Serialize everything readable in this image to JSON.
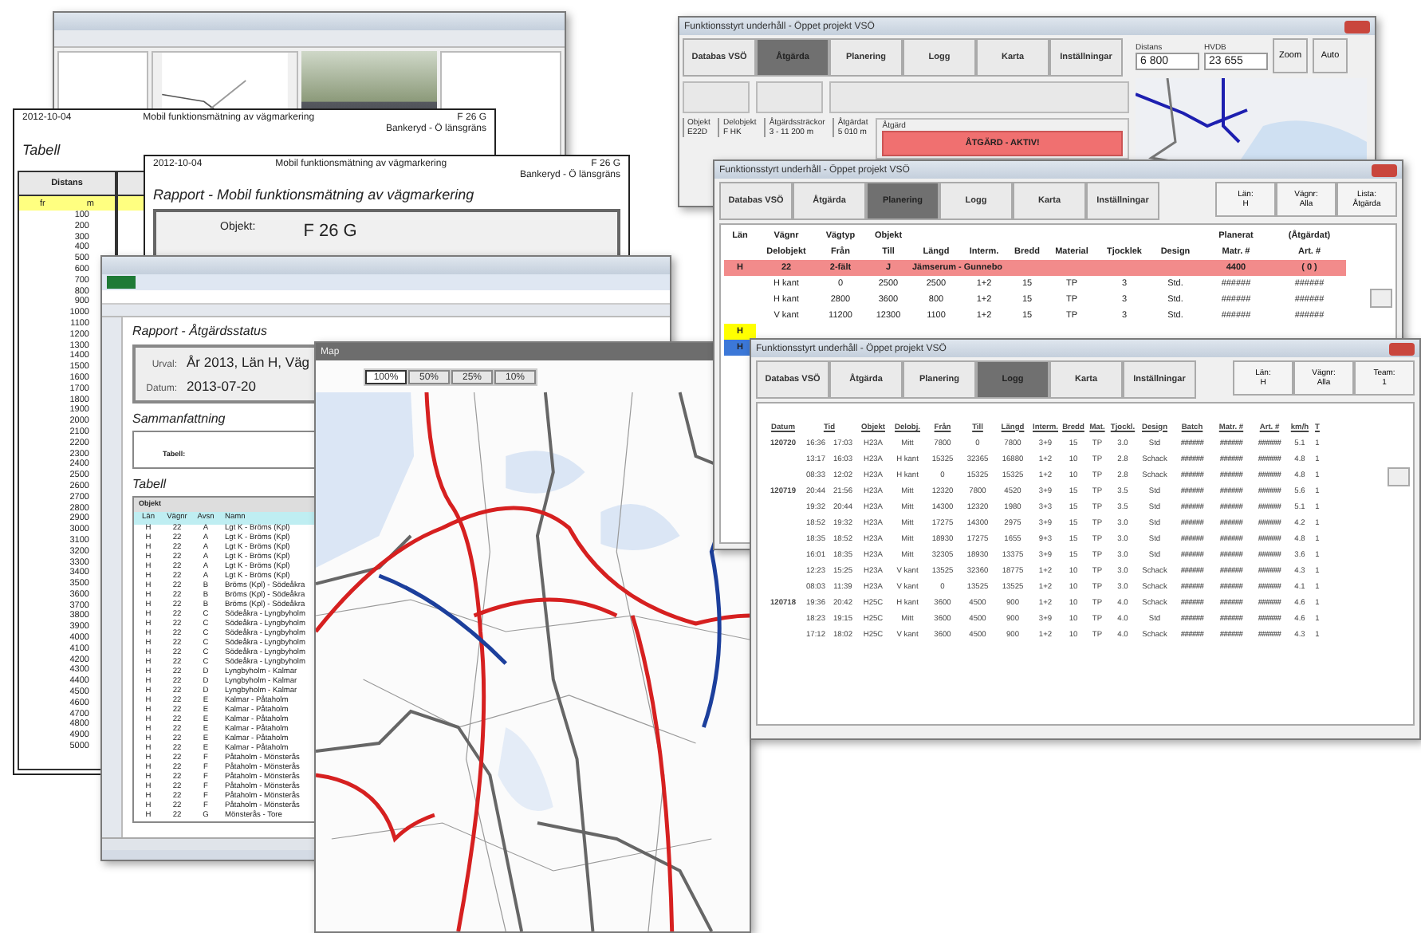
{
  "tabell_report": {
    "date": "2012-10-04",
    "title": "Mobil funktionsmätning av vägmarkering",
    "object": "F 26 G",
    "section": "Bankeryd - Ö länsgräns",
    "heading": "Tabell",
    "column": "Distans",
    "units": [
      "fr",
      "m"
    ],
    "distances": [
      "100",
      "200",
      "300",
      "400",
      "500",
      "600",
      "700",
      "800",
      "900",
      "1000",
      "1100",
      "1200",
      "1300",
      "1400",
      "1500",
      "1600",
      "1700",
      "1800",
      "1900",
      "2000",
      "2100",
      "2200",
      "2300",
      "2400",
      "2500",
      "2600",
      "2700",
      "2800",
      "2900",
      "3000",
      "3100",
      "3200",
      "3300",
      "3400",
      "3500",
      "3600",
      "3700",
      "3800",
      "3900",
      "4000",
      "4100",
      "4200",
      "4300",
      "4400",
      "4500",
      "4600",
      "4700",
      "4800",
      "4900",
      "5000"
    ]
  },
  "rapport_report": {
    "date": "2012-10-04",
    "title": "Mobil funktionsmätning av vägmarkering",
    "object": "F 26 G",
    "section": "Bankeryd - Ö länsgräns",
    "heading": "Rapport - Mobil funktionsmätning av vägmarkering",
    "object_label": "Objekt:",
    "object_value": "F 26 G"
  },
  "excel": {
    "heading": "Rapport - Åtgärdsstatus",
    "filter_label": "Urval:",
    "filter_value": "År 2013, Län H, Väg",
    "date_label": "Datum:",
    "date_value": "2013-07-20",
    "summary_heading": "Sammanfattning",
    "summary_label": "Tabell:",
    "table_heading": "Tabell",
    "group_header": "Objekt",
    "columns": [
      "Län",
      "Vägnr",
      "Avsn",
      "Namn"
    ],
    "rows": [
      [
        "H",
        "22",
        "A",
        "Lgt K - Bröms (Kpl)"
      ],
      [
        "H",
        "22",
        "A",
        "Lgt K - Bröms (Kpl)"
      ],
      [
        "H",
        "22",
        "A",
        "Lgt K - Bröms (Kpl)"
      ],
      [
        "H",
        "22",
        "A",
        "Lgt K - Bröms (Kpl)"
      ],
      [
        "H",
        "22",
        "A",
        "Lgt K - Bröms (Kpl)"
      ],
      [
        "H",
        "22",
        "A",
        "Lgt K - Bröms (Kpl)"
      ],
      [
        "H",
        "22",
        "B",
        "Bröms (Kpl) - Södeåkra"
      ],
      [
        "H",
        "22",
        "B",
        "Bröms (Kpl) - Södeåkra"
      ],
      [
        "H",
        "22",
        "B",
        "Bröms (Kpl) - Södeåkra"
      ],
      [
        "H",
        "22",
        "C",
        "Södeåkra - Lyngbyholm"
      ],
      [
        "H",
        "22",
        "C",
        "Södeåkra - Lyngbyholm"
      ],
      [
        "H",
        "22",
        "C",
        "Södeåkra - Lyngbyholm"
      ],
      [
        "H",
        "22",
        "C",
        "Södeåkra - Lyngbyholm"
      ],
      [
        "H",
        "22",
        "C",
        "Södeåkra - Lyngbyholm"
      ],
      [
        "H",
        "22",
        "C",
        "Södeåkra - Lyngbyholm"
      ],
      [
        "H",
        "22",
        "D",
        "Lyngbyholm - Kalmar"
      ],
      [
        "H",
        "22",
        "D",
        "Lyngbyholm - Kalmar"
      ],
      [
        "H",
        "22",
        "D",
        "Lyngbyholm - Kalmar"
      ],
      [
        "H",
        "22",
        "E",
        "Kalmar - Påtaholm"
      ],
      [
        "H",
        "22",
        "E",
        "Kalmar - Påtaholm"
      ],
      [
        "H",
        "22",
        "E",
        "Kalmar - Påtaholm"
      ],
      [
        "H",
        "22",
        "E",
        "Kalmar - Påtaholm"
      ],
      [
        "H",
        "22",
        "E",
        "Kalmar - Påtaholm"
      ],
      [
        "H",
        "22",
        "E",
        "Kalmar - Påtaholm"
      ],
      [
        "H",
        "22",
        "F",
        "Påtaholm - Mönsterås"
      ],
      [
        "H",
        "22",
        "F",
        "Påtaholm - Mönsterås"
      ],
      [
        "H",
        "22",
        "F",
        "Påtaholm - Mönsterås"
      ],
      [
        "H",
        "22",
        "F",
        "Påtaholm - Mönsterås"
      ],
      [
        "H",
        "22",
        "F",
        "Påtaholm - Mönsterås"
      ],
      [
        "H",
        "22",
        "F",
        "Påtaholm - Mönsterås"
      ],
      [
        "H",
        "22",
        "G",
        "Mönsterås - Tore"
      ]
    ]
  },
  "map_window": {
    "title": "Map",
    "zoom_buttons": [
      {
        "label": "100%",
        "selected": true
      },
      {
        "label": "50%",
        "selected": false
      },
      {
        "label": "25%",
        "selected": false
      },
      {
        "label": "10%",
        "selected": false
      }
    ]
  },
  "action_window": {
    "title": "Funktionsstyrt underhåll - Öppet projekt VSÖ",
    "tabs": [
      {
        "label": "Databas VSÖ",
        "selected": false
      },
      {
        "label": "Åtgärda",
        "selected": true
      },
      {
        "label": "Planering",
        "selected": false
      },
      {
        "label": "Logg",
        "selected": false
      },
      {
        "label": "Karta",
        "selected": false
      },
      {
        "label": "Inställningar",
        "selected": false
      }
    ],
    "distance_label": "Distans",
    "distance": "6 800",
    "hvdb_label": "HVDB",
    "hvdb": "23 655",
    "buttons": [
      "Zoom",
      "Auto"
    ],
    "fields": [
      {
        "label": "Objekt",
        "value": "E22D"
      },
      {
        "label": "Delobjekt",
        "value": "F HK"
      },
      {
        "label": "Åtgärdssträckor",
        "value": "3 - 11 200 m"
      },
      {
        "label": "Åtgärdat",
        "value": "5 010 m"
      }
    ],
    "action_label": "Åtgärd",
    "action_status": "ÅTGÄRD - AKTIV!"
  },
  "planning_window": {
    "title": "Funktionsstyrt underhåll - Öppet projekt VSÖ",
    "tabs": [
      {
        "label": "Databas VSÖ",
        "selected": false
      },
      {
        "label": "Åtgärda",
        "selected": false
      },
      {
        "label": "Planering",
        "selected": true
      },
      {
        "label": "Logg",
        "selected": false
      },
      {
        "label": "Karta",
        "selected": false
      },
      {
        "label": "Inställningar",
        "selected": false
      }
    ],
    "filters": [
      {
        "label": "Län:",
        "value": "H"
      },
      {
        "label": "Vägnr:",
        "value": "Alla"
      },
      {
        "label": "Lista:",
        "value": "Åtgärda"
      }
    ],
    "columns": [
      {
        "top": "Län"
      },
      {
        "top": "Vägnr",
        "label": "Delobjekt"
      },
      {
        "top": "Vägtyp",
        "label": "Från"
      },
      {
        "top": "Objekt",
        "label": "Till"
      },
      {
        "label": "Längd"
      },
      {
        "label": "Interm."
      },
      {
        "label": "Bredd"
      },
      {
        "label": "Material"
      },
      {
        "label": "Tjocklek"
      },
      {
        "label": "Design"
      },
      {
        "top": "Planerat",
        "label": "Matr. #"
      },
      {
        "top": "(Åtgärdat)",
        "label": "Art. #"
      }
    ],
    "rows": [
      {
        "kind": "object",
        "cells": [
          "H",
          "22",
          "2-fält",
          "J",
          "Jämserum - Gunnebo",
          "",
          "",
          "",
          "",
          "",
          "4400",
          "( 0 )"
        ]
      },
      {
        "kind": "part",
        "cells": [
          "",
          "H kant",
          "0",
          "2500",
          "2500",
          "1+2",
          "15",
          "TP",
          "3",
          "Std.",
          "######",
          "######"
        ]
      },
      {
        "kind": "part",
        "cells": [
          "",
          "H kant",
          "2800",
          "3600",
          "800",
          "1+2",
          "15",
          "TP",
          "3",
          "Std.",
          "######",
          "######"
        ]
      },
      {
        "kind": "part",
        "cells": [
          "",
          "V kant",
          "11200",
          "12300",
          "1100",
          "1+2",
          "15",
          "TP",
          "3",
          "Std.",
          "######",
          "######"
        ]
      },
      {
        "kind": "marker",
        "cells": [
          "H"
        ],
        "color": "#ffff00"
      },
      {
        "kind": "marker",
        "cells": [
          "H"
        ],
        "color": "#3c78d8"
      }
    ]
  },
  "log_window": {
    "title": "Funktionsstyrt underhåll - Öppet projekt VSÖ",
    "tabs": [
      {
        "label": "Databas VSÖ",
        "selected": false
      },
      {
        "label": "Åtgärda",
        "selected": false
      },
      {
        "label": "Planering",
        "selected": false
      },
      {
        "label": "Logg",
        "selected": true
      },
      {
        "label": "Karta",
        "selected": false
      },
      {
        "label": "Inställningar",
        "selected": false
      }
    ],
    "filters": [
      {
        "label": "Län:",
        "value": "H"
      },
      {
        "label": "Vägnr:",
        "value": "Alla"
      },
      {
        "label": "Team:",
        "value": "1"
      }
    ],
    "header": [
      "Datum",
      "Tid",
      "Objekt",
      "Delobj.",
      "Från",
      "Till",
      "Längd",
      "Interm.",
      "Bredd",
      "Mat.",
      "Tjockl.",
      "Design",
      "Batch",
      "Matr. #",
      "Art. #",
      "km/h",
      "T"
    ],
    "rows": [
      {
        "date": "120720",
        "cells": [
          "16:36",
          "17:03",
          "H23A",
          "Mitt",
          "7800",
          "0",
          "7800",
          "3+9",
          "15",
          "TP",
          "3.0",
          "Std",
          "######",
          "######",
          "######",
          "5.1",
          "1"
        ]
      },
      {
        "cells": [
          "13:17",
          "16:03",
          "H23A",
          "H kant",
          "15325",
          "32365",
          "16880",
          "1+2",
          "10",
          "TP",
          "2.8",
          "Schack",
          "######",
          "######",
          "######",
          "4.8",
          "1"
        ]
      },
      {
        "cells": [
          "08:33",
          "12:02",
          "H23A",
          "H kant",
          "0",
          "15325",
          "15325",
          "1+2",
          "10",
          "TP",
          "2.8",
          "Schack",
          "######",
          "######",
          "######",
          "4.8",
          "1"
        ]
      },
      {
        "date": "120719",
        "cells": [
          "20:44",
          "21:56",
          "H23A",
          "Mitt",
          "12320",
          "7800",
          "4520",
          "3+9",
          "15",
          "TP",
          "3.5",
          "Std",
          "######",
          "######",
          "######",
          "5.6",
          "1"
        ]
      },
      {
        "cells": [
          "19:32",
          "20:44",
          "H23A",
          "Mitt",
          "14300",
          "12320",
          "1980",
          "3+3",
          "15",
          "TP",
          "3.5",
          "Std",
          "######",
          "######",
          "######",
          "5.1",
          "1"
        ]
      },
      {
        "cells": [
          "18:52",
          "19:32",
          "H23A",
          "Mitt",
          "17275",
          "14300",
          "2975",
          "3+9",
          "15",
          "TP",
          "3.0",
          "Std",
          "######",
          "######",
          "######",
          "4.2",
          "1"
        ]
      },
      {
        "cells": [
          "18:35",
          "18:52",
          "H23A",
          "Mitt",
          "18930",
          "17275",
          "1655",
          "9+3",
          "15",
          "TP",
          "3.0",
          "Std",
          "######",
          "######",
          "######",
          "4.8",
          "1"
        ]
      },
      {
        "cells": [
          "16:01",
          "18:35",
          "H23A",
          "Mitt",
          "32305",
          "18930",
          "13375",
          "3+9",
          "15",
          "TP",
          "3.0",
          "Std",
          "######",
          "######",
          "######",
          "3.6",
          "1"
        ]
      },
      {
        "cells": [
          "12:23",
          "15:25",
          "H23A",
          "V kant",
          "13525",
          "32360",
          "18775",
          "1+2",
          "10",
          "TP",
          "3.0",
          "Schack",
          "######",
          "######",
          "######",
          "4.3",
          "1"
        ]
      },
      {
        "cells": [
          "08:03",
          "11:39",
          "H23A",
          "V kant",
          "0",
          "13525",
          "13525",
          "1+2",
          "10",
          "TP",
          "3.0",
          "Schack",
          "######",
          "######",
          "######",
          "4.1",
          "1"
        ]
      },
      {
        "date": "120718",
        "cells": [
          "19:36",
          "20:42",
          "H25C",
          "H kant",
          "3600",
          "4500",
          "900",
          "1+2",
          "10",
          "TP",
          "4.0",
          "Schack",
          "######",
          "######",
          "######",
          "4.6",
          "1"
        ]
      },
      {
        "cells": [
          "18:23",
          "19:15",
          "H25C",
          "Mitt",
          "3600",
          "4500",
          "900",
          "3+9",
          "10",
          "TP",
          "4.0",
          "Std",
          "######",
          "######",
          "######",
          "4.6",
          "1"
        ]
      },
      {
        "cells": [
          "17:12",
          "18:02",
          "H25C",
          "V kant",
          "3600",
          "4500",
          "900",
          "1+2",
          "10",
          "TP",
          "4.0",
          "Schack",
          "######",
          "######",
          "######",
          "4.3",
          "1"
        ]
      }
    ]
  }
}
